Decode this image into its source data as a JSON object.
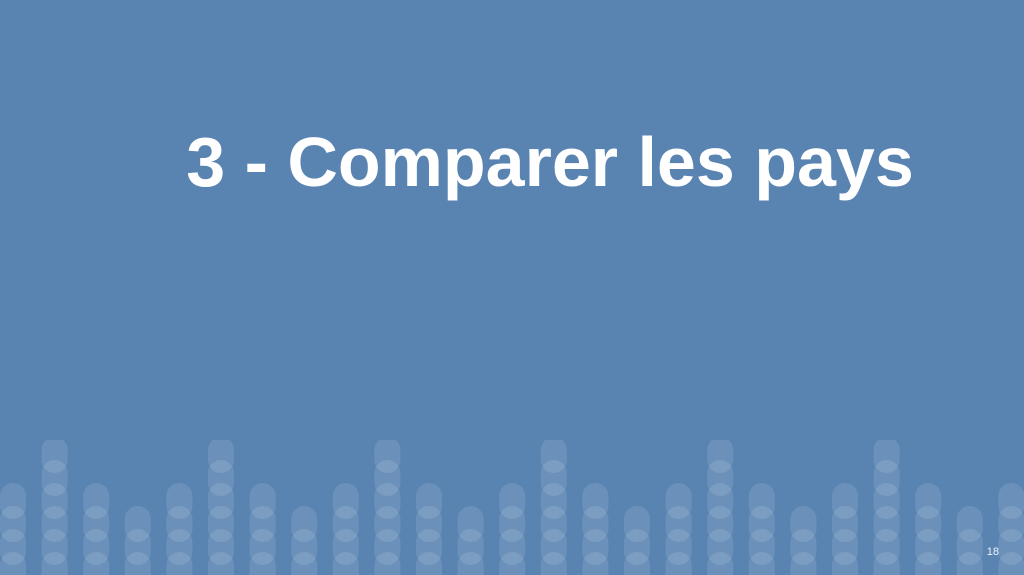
{
  "slide": {
    "title": "3 - Comparer les pays",
    "page_number": "18",
    "colors": {
      "background": "#5984b2",
      "text": "#ffffff",
      "bars": "#ffffff"
    }
  }
}
